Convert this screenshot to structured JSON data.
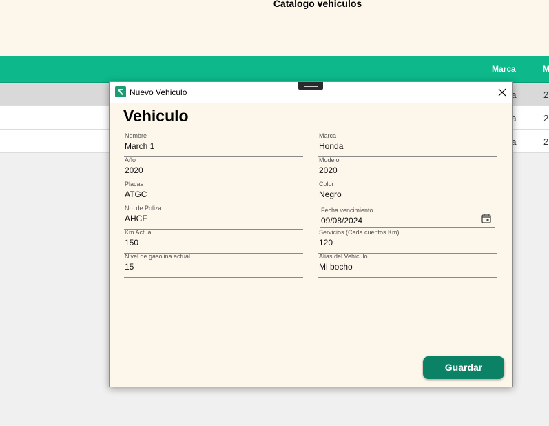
{
  "background": {
    "title": "Catalogo vehiculos",
    "columns": [
      "Marca",
      "M"
    ],
    "rows": [
      {
        "marca": "da",
        "next": "2"
      },
      {
        "marca": "da",
        "next": "2"
      },
      {
        "marca": "da",
        "next": "2"
      }
    ]
  },
  "dialog": {
    "window_title": "Nuevo Vehiculo",
    "heading": "Vehiculo",
    "save_label": "Guardar",
    "fields": {
      "nombre": {
        "label": "Nombre",
        "value": "March 1"
      },
      "marca": {
        "label": "Marca",
        "value": "Honda"
      },
      "anio": {
        "label": "Año",
        "value": "2020"
      },
      "modelo": {
        "label": "Modelo",
        "value": "2020"
      },
      "placas": {
        "label": "Placas",
        "value": "ATGC"
      },
      "color": {
        "label": "Color",
        "value": "Negro"
      },
      "poliza": {
        "label": "No. de Poliza",
        "value": "AHCF"
      },
      "fecha": {
        "label": "Fecha vencimiento",
        "value": "09/08/2024"
      },
      "km": {
        "label": "Km Actual",
        "value": "150"
      },
      "servicios": {
        "label": "Servicios (Cada cuentos Km)",
        "value": "120"
      },
      "gasolina": {
        "label": "Nivel de gasolina actual",
        "value": "15"
      },
      "alias": {
        "label": "Alias del Vehiculo",
        "value": "Mi bocho"
      }
    }
  },
  "colors": {
    "accent": "#0db88a",
    "button": "#0b8266",
    "panel": "#fdf6ea"
  }
}
